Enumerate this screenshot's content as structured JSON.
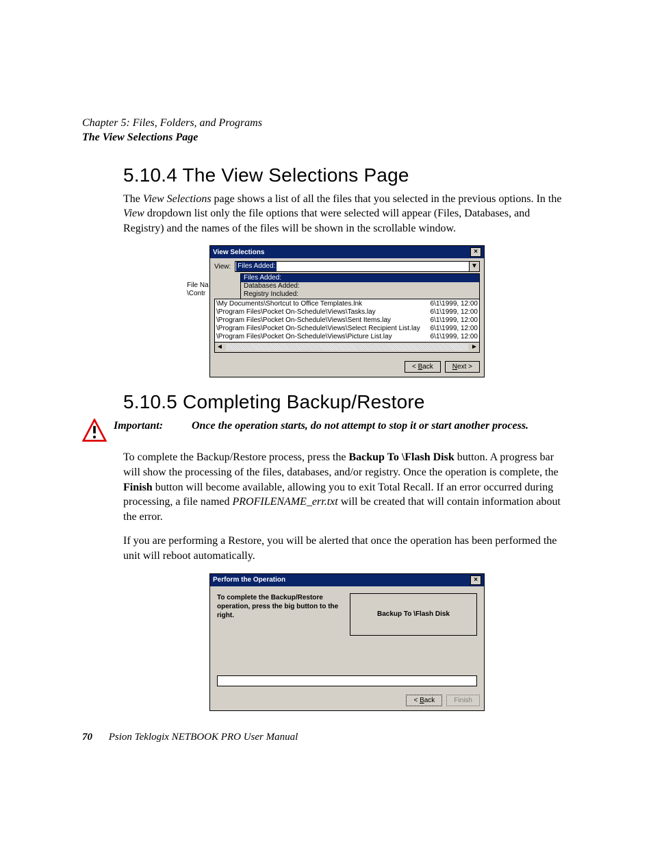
{
  "header": {
    "chapter": "Chapter 5:  Files, Folders, and Programs",
    "section": "The View Selections Page"
  },
  "s1": {
    "heading": "5.10.4  The View Selections Page",
    "para": "The View Selections page shows a list of all the files that you selected in the previous options. In the View dropdown list only the file options that were selected will appear (Files, Databases, and Registry) and the names of the files will be shown in the scrollable window.",
    "para_prefix": "The ",
    "para_em": "View Selections",
    "para_mid": " page shows a list of all the files that you selected in the previous options. In the ",
    "para_em2": "View",
    "para_suffix": " dropdown list only the file options that were selected will appear (Files, Databases, and Registry) and the names of the files will be shown in the scrollable window."
  },
  "dlg1": {
    "title": "View Selections",
    "view_label": "View:",
    "selected": "Files Added:",
    "options": [
      "Files Added:",
      "Databases Added:",
      "Registry Included:"
    ],
    "left_col_hint1": "File Na",
    "left_col_hint2": "\\Contr",
    "rows": [
      {
        "path": "\\My Documents\\Shortcut to Office Templates.lnk",
        "ts": "6\\1\\1999,  12:00"
      },
      {
        "path": "\\Program Files\\Pocket On-Schedule\\Views\\Tasks.lay",
        "ts": "6\\1\\1999,  12:00"
      },
      {
        "path": "\\Program Files\\Pocket On-Schedule\\Views\\Sent Items.lay",
        "ts": "6\\1\\1999,  12:00"
      },
      {
        "path": "\\Program Files\\Pocket On-Schedule\\Views\\Select Recipient List.lay",
        "ts": "6\\1\\1999,  12:00"
      },
      {
        "path": "\\Program Files\\Pocket On-Schedule\\Views\\Picture List.lay",
        "ts": "6\\1\\1999,  12:00"
      }
    ],
    "back": "< Back",
    "next": "Next >",
    "back_u": "B",
    "next_u": "N"
  },
  "s2": {
    "heading": "5.10.5  Completing Backup/Restore",
    "important_label": "Important:",
    "important_text": "Once the operation starts, do not attempt to stop it or start another process.",
    "p1_a": "To complete the Backup/Restore process, press the ",
    "p1_b": "Backup To \\Flash Disk",
    "p1_c": " button. A progress bar will show the processing of the files, databases, and/or registry. Once the operation is complete, the ",
    "p1_d": "Finish",
    "p1_e": " button will become available, allowing you to exit Total Recall. If an error occurred during processing, a file named ",
    "p1_f": "PROFILENAME_err.txt",
    "p1_g": " will be created that will contain information about the error.",
    "p2": "If you are performing a Restore, you will be alerted that once the operation has been performed the unit will reboot automatically."
  },
  "dlg2": {
    "title": "Perform the Operation",
    "instr": "To complete the Backup/Restore operation, press the big button to the right.",
    "bigbtn": "Backup To  \\Flash Disk",
    "back": "< Back",
    "finish": "Finish",
    "back_u": "B"
  },
  "footer": {
    "page": "70",
    "book": "Psion Teklogix NETBOOK PRO User Manual"
  }
}
